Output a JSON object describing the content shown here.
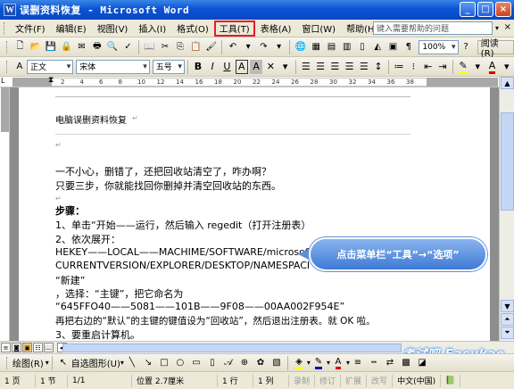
{
  "window": {
    "app_icon": "W",
    "title": "误删资料恢复 - Microsoft Word",
    "buttons": {
      "minimize": "_",
      "maximize": "□",
      "close": "×"
    }
  },
  "menu": {
    "items": [
      "文件(F)",
      "编辑(E)",
      "视图(V)",
      "插入(I)",
      "格式(O)",
      "工具(T)",
      "表格(A)",
      "窗口(W)",
      "帮助(H)"
    ],
    "highlighted_index": 5,
    "ask_placeholder": "键入需要帮助的问题",
    "close": "×"
  },
  "toolbar_standard": {
    "zoom": "100%",
    "read_label": "阅读(R)"
  },
  "toolbar_format": {
    "style": "正文",
    "font": "宋体",
    "size": "五号",
    "bold": "B",
    "italic": "I",
    "underline": "U",
    "char_border": "A",
    "char_shade": "A"
  },
  "ruler": {
    "numbers": [
      "2",
      "4",
      "6",
      "8",
      "10",
      "12",
      "14",
      "16",
      "18",
      "20",
      "22",
      "24",
      "26",
      "28",
      "30",
      "32",
      "34",
      "36",
      "38"
    ]
  },
  "document": {
    "header_text": "电脑误删资料恢复",
    "lines": [
      "一不小心，删错了，还把回收站清空了，咋办啊？",
      "只要三步，你就能找回你删掉并清空回收站的东西。",
      "步骤：",
      "1、单击“开始——运行，然后输入 regedit（打开注册表）",
      "2、依次展开：",
      "HEKEY——LOCAL——MACHIME/SOFTWARE/microsoft/WINDOWS/",
      "CURRENTVERSION/EXPLORER/DESKTOP/NAMESPACE",
      "“新建”",
      "，选择：“主键”，把它命名为",
      "“645FFO40——5081——101B——9F08——00AA002F954E”",
      "再把右边的“默认”的主键的键值设为“回收站”，然后退出注册表。就 OK 啦。",
      "3、要重启计算机。"
    ]
  },
  "callout": {
    "text": "点击菜单栏“工具”→“选项”"
  },
  "drawbar": {
    "draw_label": "绘图(R)",
    "autoshape_label": "自选图形(U)"
  },
  "status": {
    "page": "1 页",
    "section": "1 节",
    "pages": "1/1",
    "position": "位置 2.7厘米",
    "line": "1 行",
    "col": "1 列",
    "rec": "录制",
    "trk": "修订",
    "ext": "扩展",
    "ovr": "改写",
    "lang": "中文(中国)"
  },
  "watermark": "考试吧 Easykao"
}
